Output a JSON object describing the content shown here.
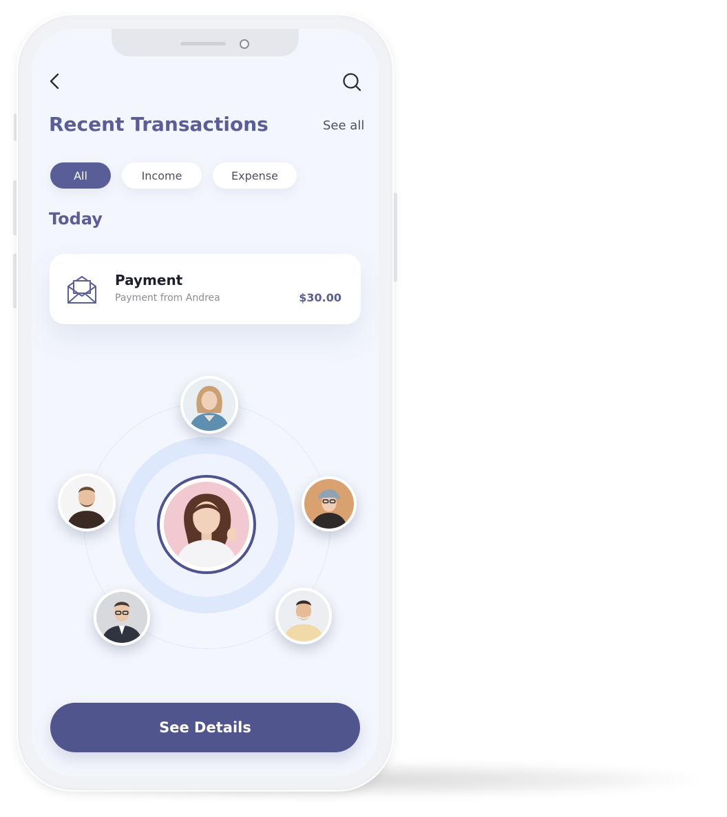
{
  "header": {
    "back_icon": "chevron-left-icon",
    "search_icon": "search-icon",
    "title": "Recent Transactions",
    "see_all": "See all"
  },
  "filters": [
    {
      "label": "All",
      "active": true
    },
    {
      "label": "Income",
      "active": false
    },
    {
      "label": "Expense",
      "active": false
    }
  ],
  "section": {
    "today": "Today"
  },
  "transaction": {
    "icon": "envelope-open-icon",
    "title": "Payment",
    "subtitle": "Payment from Andrea",
    "amount": "$30.00"
  },
  "cta": {
    "label": "See Details"
  },
  "colors": {
    "accent": "#5a5e98",
    "button": "#51558e",
    "screen_bg": "#f3f6fc",
    "orbit": "#dde8fc"
  }
}
